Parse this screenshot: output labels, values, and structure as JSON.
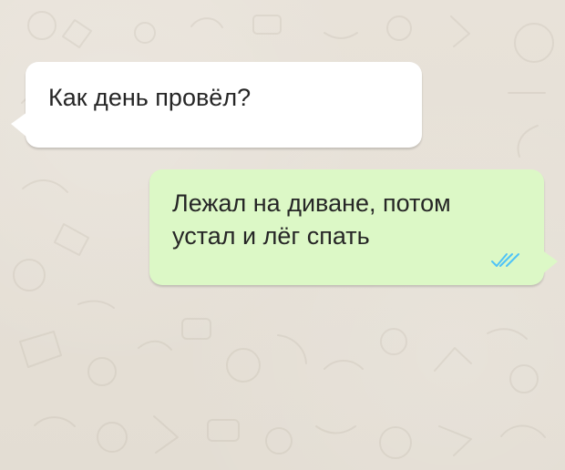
{
  "chat": {
    "background_color": "#e6e0d6",
    "messages": [
      {
        "direction": "incoming",
        "text": "Как день провёл?",
        "bubble_color": "#ffffff"
      },
      {
        "direction": "outgoing",
        "text": "Лежал на диване, потом\nустал и лёг спать",
        "bubble_color": "#dcf8c6",
        "status_icon": "double-check-icon",
        "status_color": "#4fc3f7"
      }
    ]
  }
}
